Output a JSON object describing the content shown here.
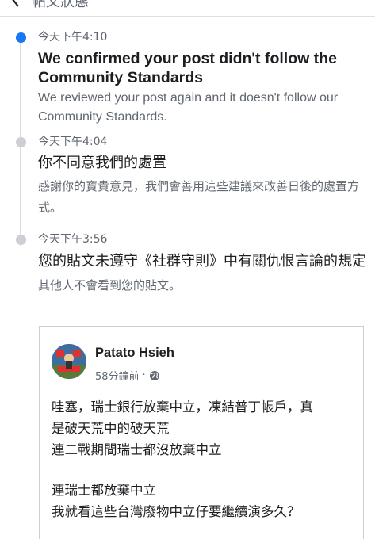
{
  "header": {
    "title": "帖文狀態"
  },
  "timeline": [
    {
      "time": "今天下午4:10",
      "title": "We confirmed your post didn't follow the Community Standards",
      "description": "We reviewed your post again and it doesn't follow our Community Standards."
    },
    {
      "time": "今天下午4:04",
      "title": "你不同意我們的處置",
      "description": "感謝你的寶貴意見，我們會善用這些建議來改善日後的處置方式。"
    },
    {
      "time": "今天下午3:56",
      "title": "您的貼文未遵守《社群守則》中有關仇恨言論的規定",
      "description": "其他人不會看到您的貼文。"
    }
  ],
  "post": {
    "author": "Patato Hsieh",
    "time_ago": "58分鐘前",
    "separator": "·",
    "lines": [
      "哇塞，瑞士銀行放棄中立，凍結普丁帳戶，真",
      "是破天荒中的破天荒",
      "連二戰期間瑞士都沒放棄中立",
      "連瑞士都放棄中立",
      "我就看這些台灣廢物中立仔要繼續演多久？"
    ]
  },
  "colors": {
    "accent": "#1877f2",
    "rail": "#dadde1",
    "muted": "#606770"
  }
}
